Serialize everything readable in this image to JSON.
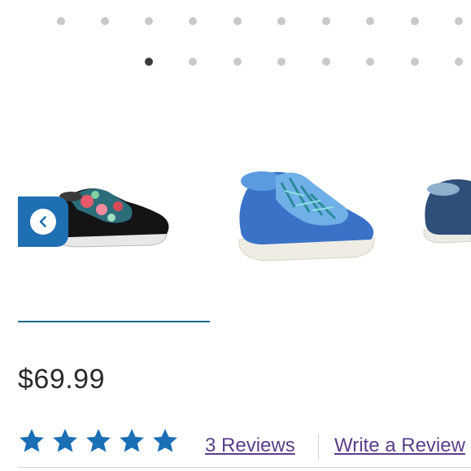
{
  "pager": {
    "row1_count": 10,
    "row2_count": 8,
    "row2_active_index": 0
  },
  "carousel": {
    "prev_icon": "chevron-left-icon",
    "thumbnails": [
      {
        "name": "black-floral-clog",
        "selected": true
      },
      {
        "name": "blue-tropical-clog",
        "selected": false
      },
      {
        "name": "navy-clog",
        "selected": false
      }
    ]
  },
  "product": {
    "price": "$69.99",
    "rating_stars": 5,
    "reviews_label": "3 Reviews",
    "write_review_label": "Write a Review"
  },
  "colors": {
    "accent": "#1f6fb3",
    "link": "#5a3e8a"
  }
}
